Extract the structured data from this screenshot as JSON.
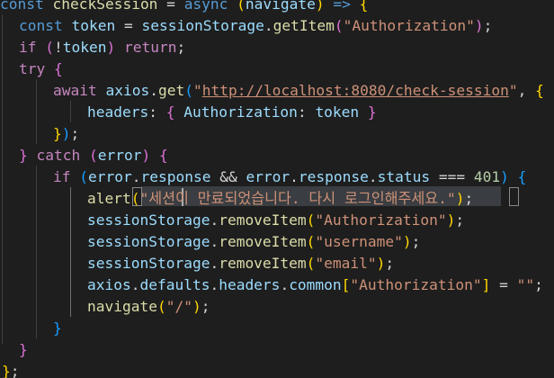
{
  "code": {
    "l1": {
      "kw_const": "const",
      "name": "checkSession",
      "eq": " = ",
      "kw_async": "async",
      "param": "navigate",
      "arrow": " => "
    },
    "l2": {
      "kw_const": "const",
      "name": "token",
      "eq": " = ",
      "obj": "sessionStorage",
      "method": "getItem",
      "arg": "\"Authorization\"",
      "semi": ";"
    },
    "l3": {
      "kw_if": "if",
      "not": "!",
      "var": "token",
      "kw_return": "return",
      "semi": ";"
    },
    "l4": {
      "kw_try": "try"
    },
    "l5": {
      "kw_await": "await",
      "obj": "axios",
      "method": "get",
      "q1": "\"",
      "url": "http://localhost:8080/check-session",
      "q2": "\"",
      "comma": ", "
    },
    "l6": {
      "key": "headers",
      "colon": ": ",
      "key2": "Authorization",
      "colon2": ": ",
      "val": "token"
    },
    "l7": {
      "semi": ";"
    },
    "l8": {
      "kw_catch": "catch",
      "param": "error"
    },
    "l9": {
      "kw_if": "if",
      "o1": "error",
      "p1": "response",
      "and": " && ",
      "o2": "error",
      "p2": "response",
      "p3": "status",
      "eqeq": " === ",
      "num": "401"
    },
    "l10": {
      "fn": "alert",
      "q1": "\"",
      "msg_a": "세션",
      "msg_b": "이 만료되었습니다. 다시 로그인해주세요.",
      "q2": "\"",
      "semi": ";"
    },
    "l11": {
      "obj": "sessionStorage",
      "method": "removeItem",
      "arg": "\"Authorization\"",
      "semi": ";"
    },
    "l12": {
      "obj": "sessionStorage",
      "method": "removeItem",
      "arg": "\"username\"",
      "semi": ";"
    },
    "l13": {
      "obj": "sessionStorage",
      "method": "removeItem",
      "arg": "\"email\"",
      "semi": ";"
    },
    "l14": {
      "o1": "axios",
      "p1": "defaults",
      "p2": "headers",
      "p3": "common",
      "key": "\"Authorization\"",
      "eq": " = ",
      "val": "\"\"",
      "semi": ";"
    },
    "l15": {
      "fn": "navigate",
      "arg": "\"/\"",
      "semi": ";"
    },
    "l18": {
      "semi": ";"
    }
  },
  "colors": {
    "background": "#1e1e1e",
    "keyword_storage": "#569cd6",
    "keyword_control": "#c586c0",
    "variable": "#9cdcfe",
    "function": "#dcdcaa",
    "string": "#ce9178",
    "number": "#b5cea8",
    "bracket_level1": "#ffd700",
    "bracket_level2": "#da70d6",
    "bracket_level3": "#179fff"
  }
}
